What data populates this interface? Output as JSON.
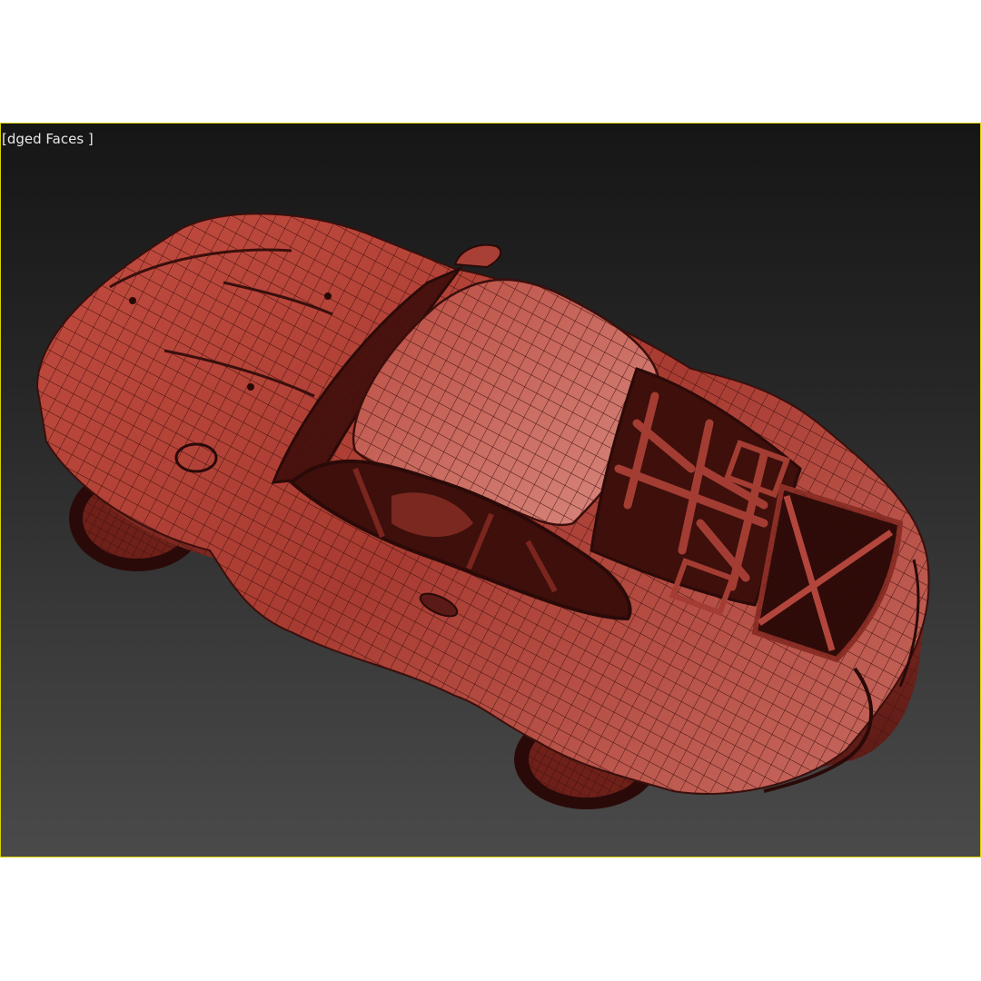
{
  "viewport": {
    "label": "[dged Faces ]",
    "border_color": "#d8d000",
    "background_top": "#161616",
    "background_bottom": "#4a4a4a"
  },
  "model": {
    "shading": "edged-faces",
    "body_color": "#b5463c",
    "wire_color": "#3a0f0c",
    "shadow_color": "#2a0a08"
  }
}
